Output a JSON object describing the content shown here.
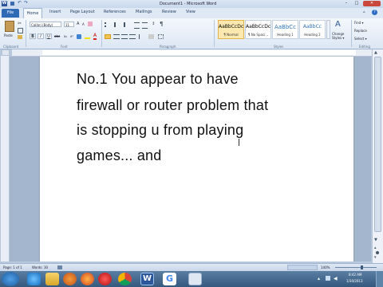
{
  "window": {
    "title": "Document1 - Microsoft Word",
    "min": "–",
    "max": "□",
    "close": "✕"
  },
  "ribbon_tabs": [
    "File",
    "Home",
    "Insert",
    "Page Layout",
    "References",
    "Mailings",
    "Review",
    "View"
  ],
  "clipboard": {
    "paste_label": "Paste",
    "group": "Clipboard"
  },
  "font": {
    "name": "Calibri (Body)",
    "size": "11",
    "group": "Font",
    "bold": "B",
    "italic": "I",
    "underline": "U"
  },
  "paragraph": {
    "group": "Paragraph"
  },
  "styles": {
    "group": "Styles",
    "items": [
      {
        "sample": "AaBbCcDc",
        "name": "¶ Normal"
      },
      {
        "sample": "AaBbCcDc",
        "name": "¶ No Spaci..."
      },
      {
        "sample": "AaBbCc",
        "name": "Heading 1"
      },
      {
        "sample": "AaBbCc",
        "name": "Heading 2"
      }
    ],
    "change_styles": "Change Styles ▾"
  },
  "editing": {
    "group": "Editing",
    "find": "Find ▾",
    "replace": "Replace",
    "select": "Select ▾"
  },
  "document": {
    "lines": [
      "No.1 You appear to have",
      "firewall or router problem that",
      "is stopping u from playing",
      "games... and"
    ]
  },
  "status": {
    "page": "Page: 1 of 1",
    "words": "Words: 30",
    "zoom": "140%"
  },
  "taskbar": {
    "time": "8:42 AM",
    "date": "1/30/2013"
  },
  "colors": {
    "accent": "#2b579a",
    "file_tab": "#2f6bb5",
    "taskbar": "#35597e"
  }
}
